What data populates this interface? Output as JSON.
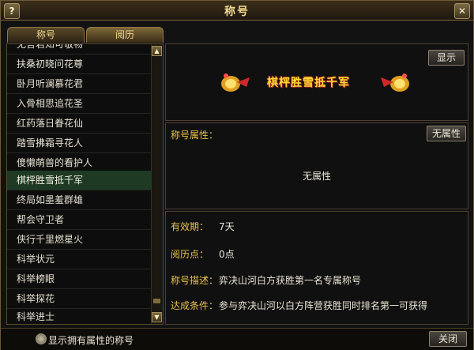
{
  "window": {
    "title": "称号",
    "help_label": "?",
    "close_label": "✕"
  },
  "tabs": [
    {
      "label": "称号",
      "active": false
    },
    {
      "label": "阅历",
      "active": true
    }
  ],
  "title_list": {
    "items": [
      {
        "label": "无言君知可敬物",
        "selected": false
      },
      {
        "label": "扶桑初晓问花尊",
        "selected": false
      },
      {
        "label": "卧月听澜慕花君",
        "selected": false
      },
      {
        "label": "入骨相思追花圣",
        "selected": false
      },
      {
        "label": "红药落日眷花仙",
        "selected": false
      },
      {
        "label": "踏雪拂霜寻花人",
        "selected": false
      },
      {
        "label": "傻懒萌兽的看护人",
        "selected": false
      },
      {
        "label": "棋枰胜雪抵千军",
        "selected": true
      },
      {
        "label": "终局如墨羞群雄",
        "selected": false
      },
      {
        "label": "帮会守卫者",
        "selected": false
      },
      {
        "label": "侠行千里燃星火",
        "selected": false
      },
      {
        "label": "科举状元",
        "selected": false
      },
      {
        "label": "科举榜眼",
        "selected": false
      },
      {
        "label": "科举探花",
        "selected": false
      },
      {
        "label": "科举进士",
        "selected": false
      }
    ],
    "scroll_up_icon": "triangle-up",
    "scroll_down_icon": "triangle-down"
  },
  "banner": {
    "title_text": "棋枰胜雪抵千军",
    "show_button": "显示"
  },
  "attributes": {
    "header": "称号属性：",
    "no_attr_button": "无属性",
    "value": "无属性"
  },
  "details": {
    "validity_label": "有效期：",
    "validity_value": "7天",
    "points_label": "阅历点：",
    "points_value": "0点",
    "desc_label": "称号描述：",
    "desc_value": "弈决山河白方获胜第一名专属称号",
    "cond_label": "达成条件：",
    "cond_value": "参与弈决山河以白方阵营获胜同时排名第一可获得"
  },
  "footer": {
    "checkbox_label": "显示拥有属性的称号",
    "close_button": "关闭"
  },
  "colors": {
    "accent_gold": "#e8c24a",
    "selected_row": "#1e3a24",
    "banner_text": "#ffde33"
  }
}
